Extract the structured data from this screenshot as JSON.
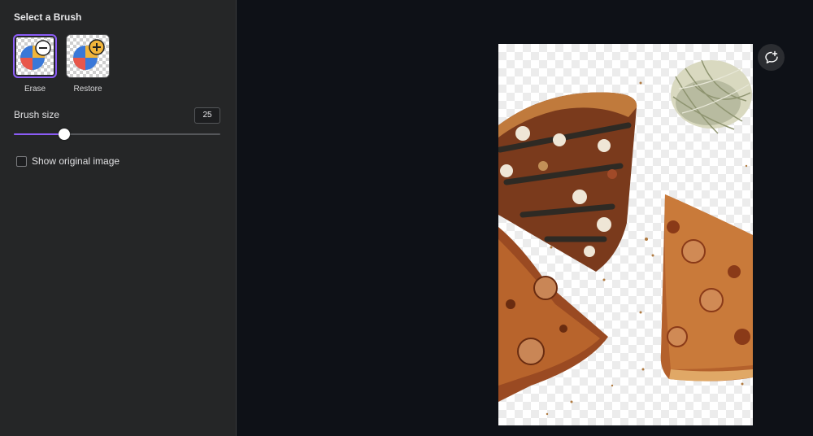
{
  "panel": {
    "title": "Select a Brush",
    "brushes": [
      {
        "label": "Erase",
        "icon": "erase-brush-icon",
        "selected": true
      },
      {
        "label": "Restore",
        "icon": "restore-brush-icon",
        "selected": false
      }
    ],
    "brush_size": {
      "label": "Brush size",
      "value": "25",
      "slider_fraction": 0.245
    },
    "show_original": {
      "label": "Show original image",
      "checked": false
    }
  },
  "canvas": {
    "image": "pizza-slices-photo",
    "comment_icon": "add-comment-icon"
  },
  "colors": {
    "panel_bg": "#252627",
    "canvas_bg": "#0e1117",
    "accent": "#8b5cf6"
  }
}
